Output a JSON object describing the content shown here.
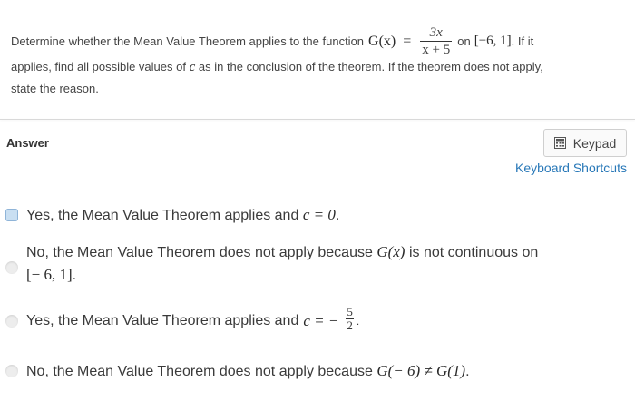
{
  "question": {
    "prefix": "Determine whether the Mean Value Theorem applies to the function",
    "func_name": "G(x)",
    "equals": "=",
    "numerator": "3x",
    "denominator": "x + 5",
    "on_word": "on",
    "interval": "[−6, 1]",
    "after_interval": ". If it",
    "line2": "applies, find all possible values of",
    "c_var": "c",
    "line2_rest": "as in the conclusion of the theorem. If the theorem does not apply,",
    "line3": "state the reason."
  },
  "answer": {
    "label": "Answer",
    "keypad_label": "Keypad",
    "shortcuts_label": "Keyboard Shortcuts"
  },
  "options": [
    {
      "text": "Yes, the Mean Value Theorem applies and",
      "math": "c = 0",
      "trailing": "."
    },
    {
      "text": "No, the Mean Value Theorem does not apply because",
      "math": "G(x)",
      "text_after": "is not continuous on",
      "line2_math": "[− 6, 1]",
      "trailing": "."
    },
    {
      "text": "Yes, the Mean Value Theorem applies and",
      "math": "c = −",
      "frac_num": "5",
      "frac_den": "2",
      "trailing": "."
    },
    {
      "text": "No, the Mean Value Theorem does not apply because",
      "math": "G(− 6) ≠ G(1)",
      "trailing": "."
    }
  ],
  "colors": {
    "link": "#2878b8",
    "selected_radio": "#c9dff2",
    "divider": "#d9d9d9"
  },
  "icons": {
    "keypad": "calculator-icon"
  }
}
